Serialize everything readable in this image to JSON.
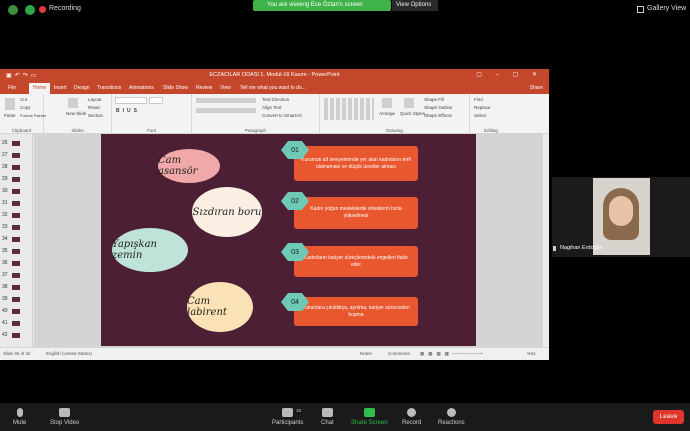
{
  "zoom": {
    "recording_label": "Recording",
    "viewing_banner": "You are viewing Ece Öztan's screen",
    "view_options": "View Options",
    "gallery_view": "Gallery View",
    "participant_name": "Nagihan Erdoğan",
    "participants_count": "15",
    "toolbar": {
      "mute": "Mute",
      "stop_video": "Stop Video",
      "participants": "Participants",
      "chat": "Chat",
      "share_screen": "Share Screen",
      "record": "Record",
      "reactions": "Reactions",
      "leave": "Leave"
    },
    "colors": {
      "share_green": "#2fbf4f",
      "leave_red": "#e0352b",
      "banner_green": "#3fb24a"
    }
  },
  "ppt": {
    "window_title": "ECZACILAR ODASI 1. Modül-16 Kasım - PowerPoint",
    "tabs": [
      "File",
      "Home",
      "Insert",
      "Design",
      "Transitions",
      "Animations",
      "Slide Show",
      "Review",
      "View"
    ],
    "active_tab": "Home",
    "tell_me": "Tell me what you want to do...",
    "share": "Share",
    "ribbon": {
      "paste": "Paste",
      "cut": "Cut",
      "copy": "Copy",
      "format_painter": "Format Painter",
      "new_slide": "New Slide",
      "layout": "Layout",
      "reset": "Reset",
      "section": "Section",
      "text_direction": "Text Direction",
      "align_text": "Align Text",
      "convert_smartart": "Convert to SmartArt",
      "arrange": "Arrange",
      "quick_styles": "Quick Styles",
      "shape_fill": "Shape Fill",
      "shape_outline": "Shape Outline",
      "shape_effects": "Shape Effects",
      "find": "Find",
      "replace": "Replace",
      "select": "Select",
      "groups": [
        "Clipboard",
        "Slides",
        "Font",
        "Paragraph",
        "Drawing",
        "Editing"
      ]
    },
    "thumb_numbers": [
      "26",
      "27",
      "28",
      "29",
      "30",
      "31",
      "32",
      "33",
      "34",
      "35",
      "36",
      "37",
      "38",
      "39",
      "40",
      "41",
      "42"
    ],
    "status": {
      "slide_of": "Slide 36 of 42",
      "language": "English (United States)",
      "notes": "Notes",
      "comments": "Comments",
      "zoom": "%61"
    },
    "accent": "#c4472b"
  },
  "slide": {
    "background": "#4d1f35",
    "ovals": [
      {
        "text": "Cam asansör",
        "color": "#f0a9a8"
      },
      {
        "text": "Sızdıran boru",
        "color": "#fbeee3"
      },
      {
        "text": "Yapışkan zemin",
        "color": "#bfe3d9"
      },
      {
        "text": "Cam labirent",
        "color": "#fbe1b6"
      }
    ],
    "steps": [
      {
        "num": "01",
        "text": "Kurumun alt seviyelerinde yer alan kadınların terfi olamaması ve düşük ücretler alması"
      },
      {
        "num": "02",
        "text": "Kadın yoğun mesleklerde erkeklerin hızla yükselmesi"
      },
      {
        "num": "03",
        "text": "Kadınların kariyer süreçlerindeki engelleri ifade eder"
      },
      {
        "num": "04",
        "text": "Yukarılara çıkıldıkça, ayrılma, kariyer sürecinden kopma"
      }
    ],
    "hex_color": "#6ec9b6",
    "box_color": "#e9572f"
  }
}
